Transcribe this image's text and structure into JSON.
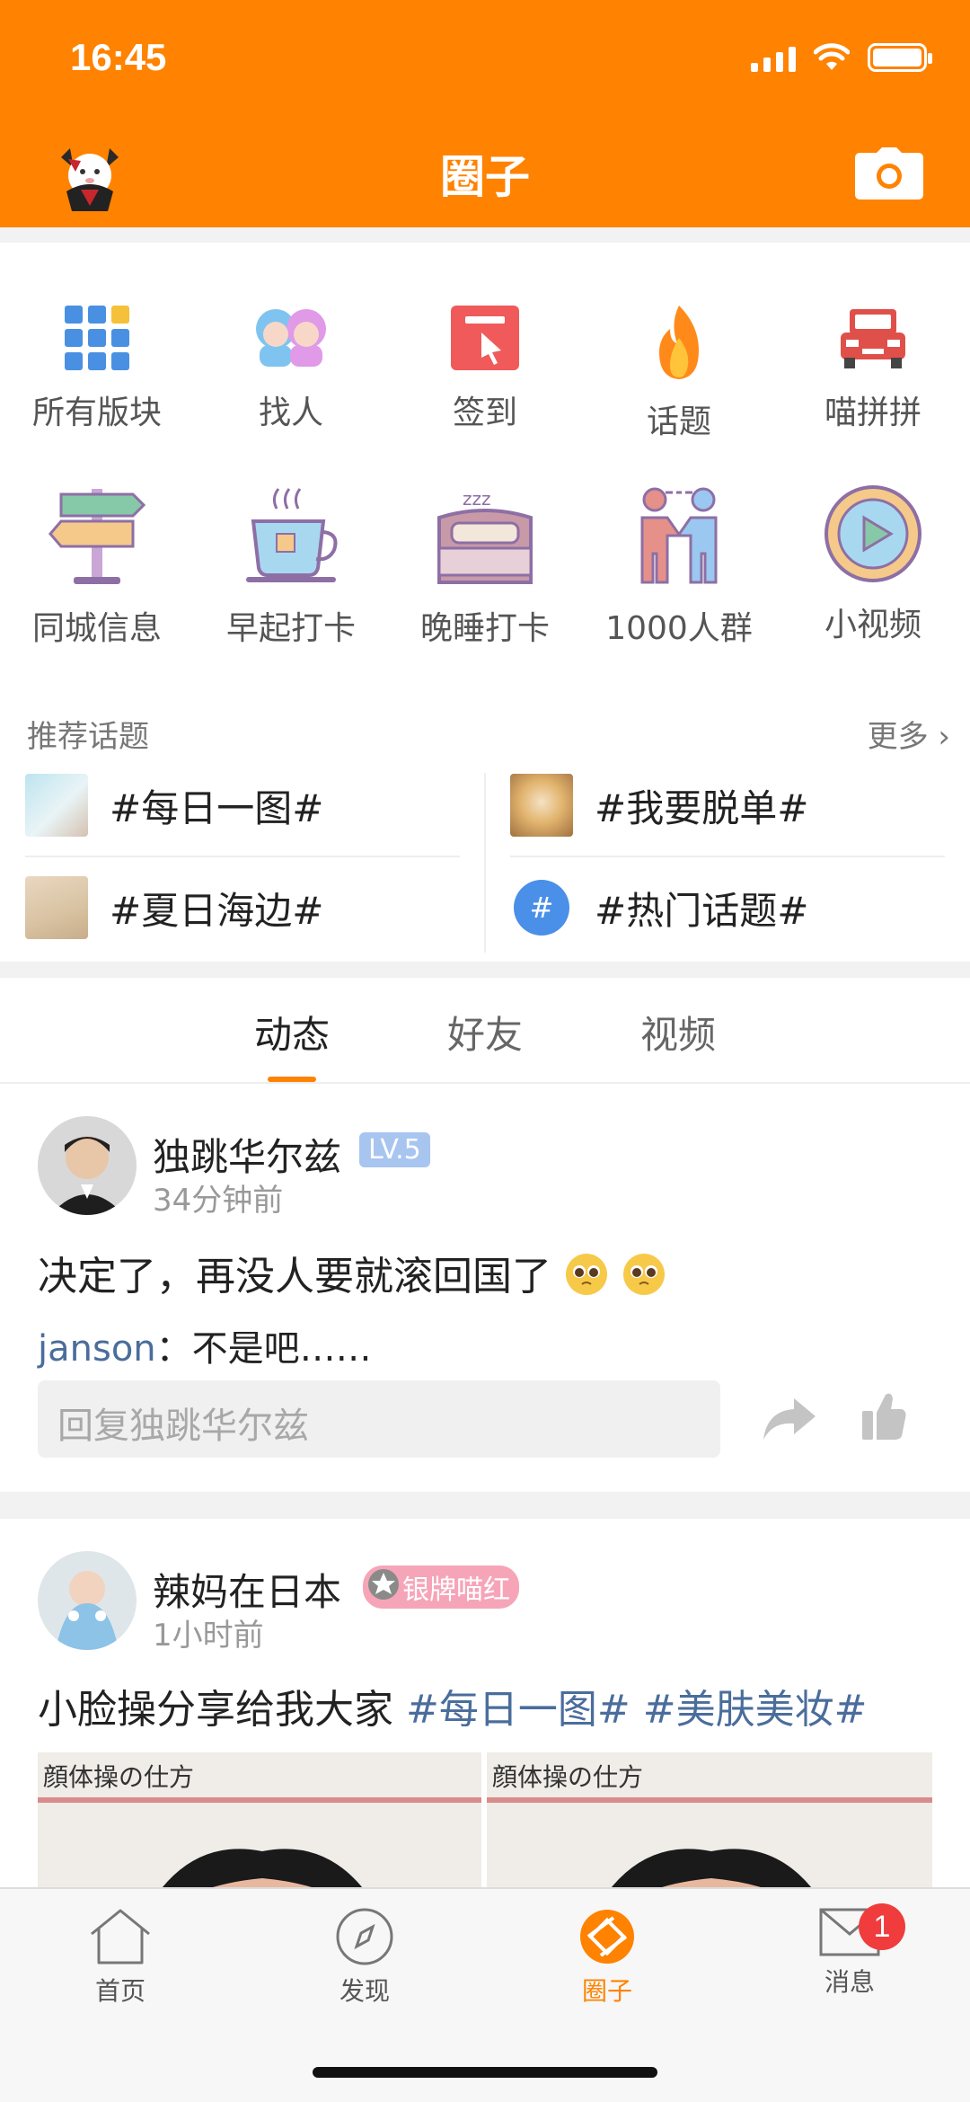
{
  "status_bar": {
    "time": "16:45"
  },
  "header": {
    "title": "圈子"
  },
  "menu": {
    "items": [
      {
        "label": "所有版块",
        "icon": "grid-icon"
      },
      {
        "label": "找人",
        "icon": "people-icon"
      },
      {
        "label": "签到",
        "icon": "checkin-icon"
      },
      {
        "label": "话题",
        "icon": "fire-icon"
      },
      {
        "label": "喵拼拼",
        "icon": "car-icon"
      },
      {
        "label": "同城信息",
        "icon": "signpost-icon"
      },
      {
        "label": "早起打卡",
        "icon": "tea-cup-icon"
      },
      {
        "label": "晚睡打卡",
        "icon": "bed-icon"
      },
      {
        "label": "1000人群",
        "icon": "handshake-icon"
      },
      {
        "label": "小视频",
        "icon": "play-icon"
      }
    ]
  },
  "topics": {
    "heading": "推荐话题",
    "more": "更多",
    "items": [
      "#每日一图#",
      "#我要脱单#",
      "#夏日海边#",
      "#热门话题#"
    ]
  },
  "tabs": [
    "动态",
    "好友",
    "视频"
  ],
  "posts": [
    {
      "user": "独跳华尔兹",
      "badge": "LV.5",
      "time": "34分钟前",
      "text": "决定了，再没人要就滚回国了",
      "reply_user": "janson",
      "reply_text": "：不是吧……",
      "reply_placeholder": "回复独跳华尔兹"
    },
    {
      "user": "辣妈在日本",
      "badge": "银牌喵红",
      "time": "1小时前",
      "text": "小脸操分享给我大家",
      "hashtags": [
        "#每日一图#",
        "#美肤美妆#"
      ],
      "photo_caption": "顔体操の仕方"
    }
  ],
  "bottom_nav": {
    "items": [
      "首页",
      "发现",
      "圈子",
      "消息"
    ],
    "active": "圈子",
    "message_badge": "1"
  },
  "colors": {
    "accent": "#ff8200",
    "hashtag": "#4a6d9c"
  }
}
